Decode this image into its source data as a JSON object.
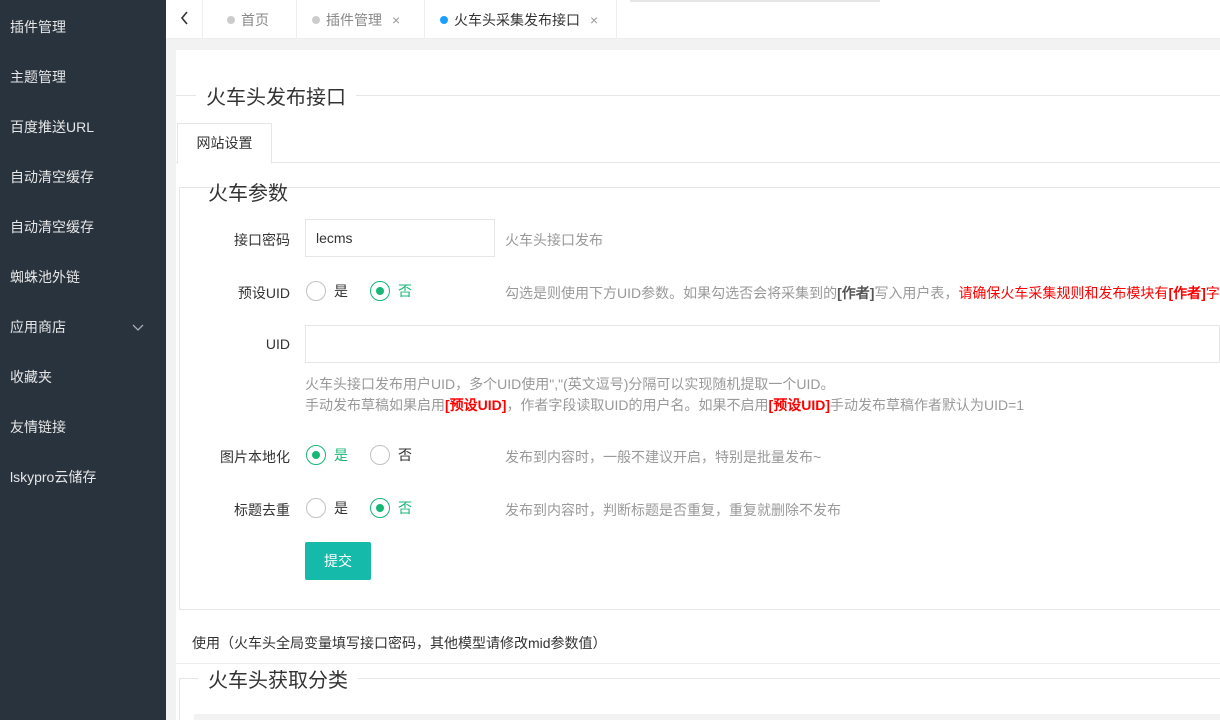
{
  "sidebar": {
    "items": [
      {
        "label": "插件管理"
      },
      {
        "label": "主题管理"
      },
      {
        "label": "百度推送URL"
      },
      {
        "label": "自动清空缓存"
      },
      {
        "label": "自动清空缓存"
      },
      {
        "label": "蜘蛛池外链"
      },
      {
        "label": "应用商店",
        "icon": "chevron-down-icon"
      },
      {
        "label": "收藏夹"
      },
      {
        "label": "友情链接"
      },
      {
        "label": "lskypro云储存"
      }
    ]
  },
  "tabbar": {
    "back_icon": "chevron-left-icon",
    "tabs": [
      {
        "label": "首页",
        "closable": false,
        "active": false
      },
      {
        "label": "插件管理",
        "closable": true,
        "active": false
      },
      {
        "label": "火车头采集发布接口",
        "closable": true,
        "active": true
      }
    ],
    "close_glyph": "×"
  },
  "main": {
    "title": "火车头发布接口",
    "subtab": "网站设置",
    "section_title": "火车参数",
    "form": {
      "password": {
        "label": "接口密码",
        "value": "lecms",
        "aux": "火车头接口发布"
      },
      "preset_uid": {
        "label": "预设UID",
        "options": [
          "是",
          "否"
        ],
        "selected": "否",
        "aux_part1": "勾选是则使用下方UID参数。如果勾选否会将采集到的",
        "aux_author": "[作者]",
        "aux_part2": "写入用户表，",
        "aux_red_part1": "请确保火车采集规则和发布模块有",
        "aux_red_author": "[作者]",
        "aux_red_tail": "字"
      },
      "uid": {
        "label": "UID",
        "value": "",
        "help1": "火车头接口发布用户UID，多个UID使用\",\"(英文逗号)分隔可以实现随机提取一个UID。",
        "help2_part1": "手动发布草稿如果启用",
        "help2_bold1": "[预设UID]",
        "help2_part2": "，作者字段读取UID的用户名。如果不启用",
        "help2_bold2": "[预设UID]",
        "help2_part3": "手动发布草稿作者默认为UID=1"
      },
      "image_local": {
        "label": "图片本地化",
        "options": [
          "是",
          "否"
        ],
        "selected": "是",
        "aux": "发布到内容时，一般不建议开启，特别是批量发布~"
      },
      "title_dedup": {
        "label": "标题去重",
        "options": [
          "是",
          "否"
        ],
        "selected": "否",
        "aux": "发布到内容时，判断标题是否重复，重复就删除不发布"
      },
      "submit_label": "提交"
    },
    "usage": "使用（火车头全局变量填写接口密码，其他模型请修改mid参数值）",
    "section2_title": "火车头获取分类"
  },
  "colors": {
    "sidebar_bg": "#28333e",
    "accent_green": "#16b777",
    "button": "#16baaa",
    "tab_active_dot": "#1e9fff",
    "red": "#ff0000"
  }
}
